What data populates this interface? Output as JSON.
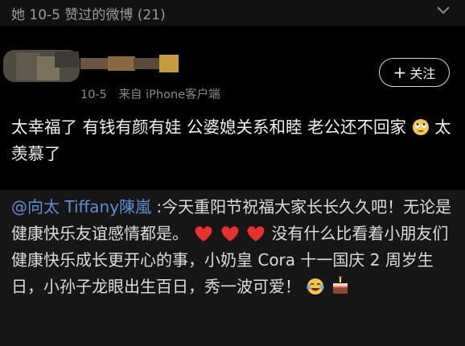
{
  "header": {
    "title": "她 10-5 赞过的微博 (21)"
  },
  "post": {
    "date": "10-5",
    "source": "来自 iPhone客户端",
    "follow_label": "关注",
    "text_part1": "太幸福了 有钱有颜有娃 公婆媳关系和睦 老公还不回家",
    "text_part2": "太羡慕了"
  },
  "repost": {
    "mention": "@向太 Tiffany陳嵐",
    "text_part1": ":今天重阳节祝福大家长长久久吧！无论是健康快乐友谊感情都是。",
    "text_part2": "没有什么比看着小朋友们健康快乐成长更开心的事，小奶皇 Cora 十一国庆 2 周岁生日，小孙子龙眼出生百日，秀一波可爱！"
  },
  "colors": {
    "mention": "#5e8ed6",
    "heart": "#e8302c",
    "background": "#000000"
  },
  "icons": [
    "chevron-down-icon",
    "plus-icon",
    "rolling-eyes-emoji",
    "heart-emoji",
    "tears-of-joy-emoji",
    "birthday-cake-emoji"
  ]
}
